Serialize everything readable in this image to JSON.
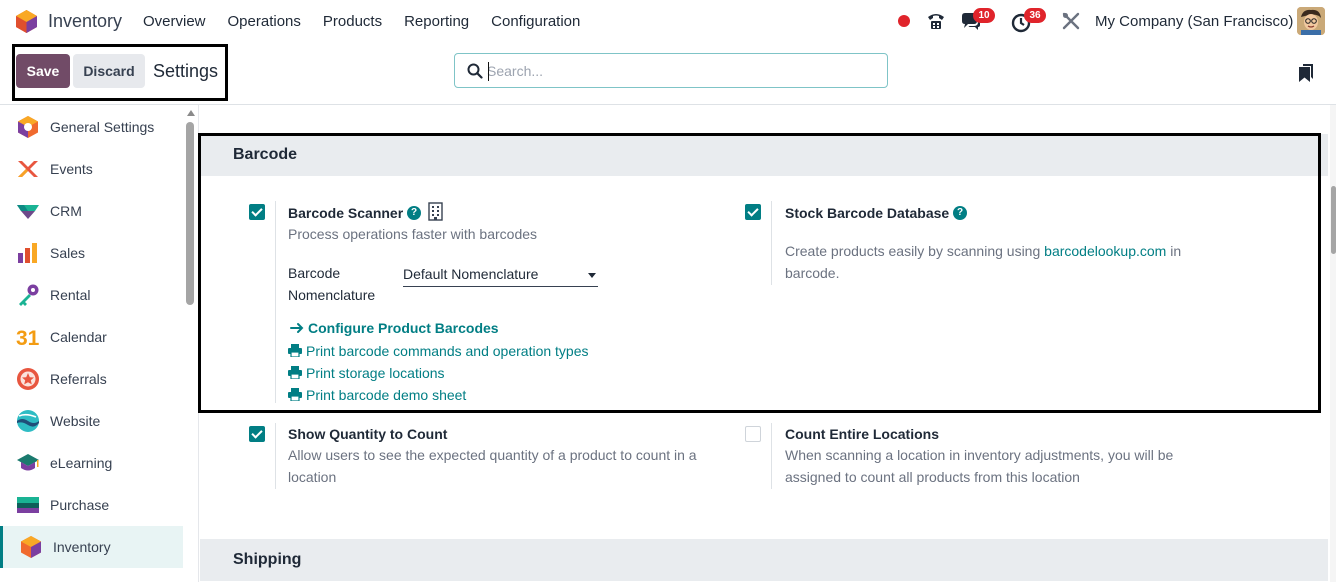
{
  "navbar": {
    "app_name": "Inventory",
    "menu": [
      "Overview",
      "Operations",
      "Products",
      "Reporting",
      "Configuration"
    ],
    "messages_count": "10",
    "activities_count": "36",
    "company": "My Company (San Francisco)"
  },
  "control_panel": {
    "save_label": "Save",
    "discard_label": "Discard",
    "title": "Settings",
    "search_placeholder": "Search..."
  },
  "sidebar": {
    "items": [
      {
        "label": "General Settings",
        "icon": "general-settings-icon"
      },
      {
        "label": "Events",
        "icon": "events-icon"
      },
      {
        "label": "CRM",
        "icon": "crm-icon"
      },
      {
        "label": "Sales",
        "icon": "sales-icon"
      },
      {
        "label": "Rental",
        "icon": "rental-icon"
      },
      {
        "label": "Calendar",
        "icon": "calendar-icon"
      },
      {
        "label": "Referrals",
        "icon": "referrals-icon"
      },
      {
        "label": "Website",
        "icon": "website-icon"
      },
      {
        "label": "eLearning",
        "icon": "elearning-icon"
      },
      {
        "label": "Purchase",
        "icon": "purchase-icon"
      },
      {
        "label": "Inventory",
        "icon": "inventory-icon",
        "active": true
      }
    ],
    "calendar_number": "31"
  },
  "barcode": {
    "section_title": "Barcode",
    "scanner": {
      "checked": true,
      "title": "Barcode Scanner",
      "description": "Process operations faster with barcodes",
      "nomenclature_label_1": "Barcode",
      "nomenclature_label_2": "Nomenclature",
      "nomenclature_value": "Default Nomenclature",
      "links": {
        "configure": "Configure Product Barcodes",
        "print_commands": "Print barcode commands and operation types",
        "print_locations": "Print storage locations",
        "print_demo": "Print barcode demo sheet"
      }
    },
    "stock_db": {
      "checked": true,
      "title": "Stock Barcode Database",
      "description_before": "Create products easily by scanning using ",
      "description_link": "barcodelookup.com",
      "description_after": " in barcode."
    },
    "show_quantity": {
      "checked": true,
      "title": "Show Quantity to Count",
      "description": "Allow users to see the expected quantity of a product to count in a location"
    },
    "count_locations": {
      "checked": false,
      "title": "Count Entire Locations",
      "description": "When scanning a location in inventory adjustments, you will be assigned to count all products from this location"
    }
  },
  "shipping": {
    "section_title": "Shipping"
  },
  "colors": {
    "brand": "#714b67",
    "accent": "#017e84",
    "badge": "#e0242b"
  }
}
